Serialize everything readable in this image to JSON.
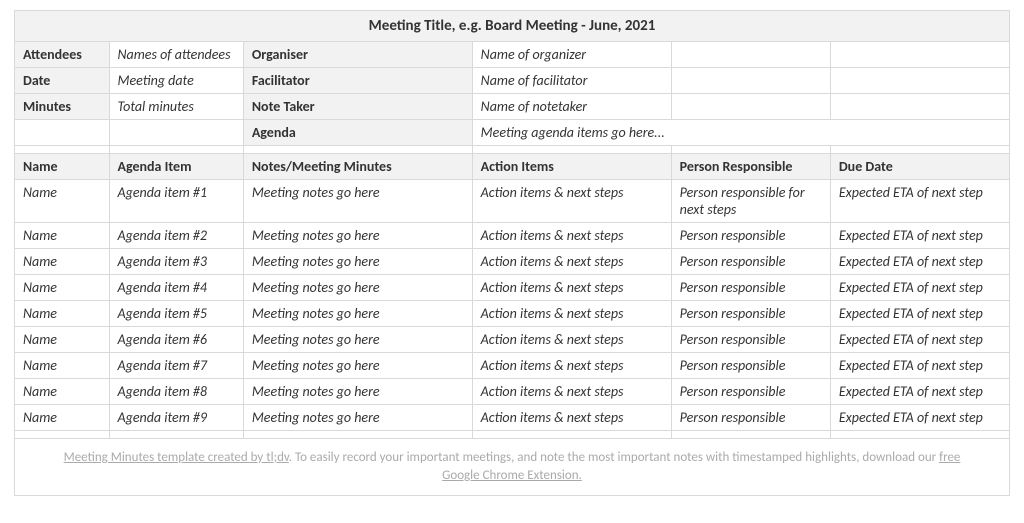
{
  "title": "Meeting Title, e.g. Board Meeting - June, 2021",
  "meta": {
    "attendees_label": "Attendees",
    "attendees_value": "Names of attendees",
    "organiser_label": "Organiser",
    "organiser_value": "Name of organizer",
    "date_label": "Date",
    "date_value": "Meeting date",
    "facilitator_label": "Facilitator",
    "facilitator_value": "Name of facilitator",
    "minutes_label": "Minutes",
    "minutes_value": "Total minutes",
    "notetaker_label": "Note Taker",
    "notetaker_value": "Name of notetaker",
    "agenda_label": "Agenda",
    "agenda_value": "Meeting agenda items go here..."
  },
  "columns": {
    "name": "Name",
    "agenda": "Agenda Item",
    "notes": "Notes/Meeting Minutes",
    "actions": "Action Items",
    "person": "Person Responsible",
    "due": "Due Date"
  },
  "rows": [
    {
      "name": "Name",
      "agenda": "Agenda item #1",
      "notes": "Meeting notes go here",
      "actions": "Action items & next steps",
      "person": "Person responsible for next steps",
      "due": "Expected ETA of next step"
    },
    {
      "name": "Name",
      "agenda": "Agenda item #2",
      "notes": "Meeting notes go here",
      "actions": "Action items & next steps",
      "person": "Person responsible",
      "due": "Expected ETA of next step"
    },
    {
      "name": "Name",
      "agenda": "Agenda item #3",
      "notes": "Meeting notes go here",
      "actions": "Action items & next steps",
      "person": "Person responsible",
      "due": "Expected ETA of next step"
    },
    {
      "name": "Name",
      "agenda": "Agenda item #4",
      "notes": "Meeting notes go here",
      "actions": "Action items & next steps",
      "person": "Person responsible",
      "due": "Expected ETA of next step"
    },
    {
      "name": "Name",
      "agenda": "Agenda item #5",
      "notes": "Meeting notes go here",
      "actions": "Action items & next steps",
      "person": "Person responsible",
      "due": "Expected ETA of next step"
    },
    {
      "name": "Name",
      "agenda": "Agenda item #6",
      "notes": "Meeting notes go here",
      "actions": "Action items & next steps",
      "person": "Person responsible",
      "due": "Expected ETA of next step"
    },
    {
      "name": "Name",
      "agenda": "Agenda item #7",
      "notes": "Meeting notes go here",
      "actions": "Action items & next steps",
      "person": "Person responsible",
      "due": "Expected ETA of next step"
    },
    {
      "name": "Name",
      "agenda": "Agenda item #8",
      "notes": "Meeting notes go here",
      "actions": "Action items & next steps",
      "person": "Person responsible",
      "due": "Expected ETA of next step"
    },
    {
      "name": "Name",
      "agenda": "Agenda item #9",
      "notes": "Meeting notes go here",
      "actions": "Action items & next steps",
      "person": "Person responsible",
      "due": "Expected ETA of next step"
    }
  ],
  "footer": {
    "link1_text": "Meeting Minutes template created by tl;dv",
    "mid_text": ". To easily record your important meetings, and note the most important notes with timestamped highlights, download our ",
    "link2_text": "free Google Chrome Extension."
  }
}
